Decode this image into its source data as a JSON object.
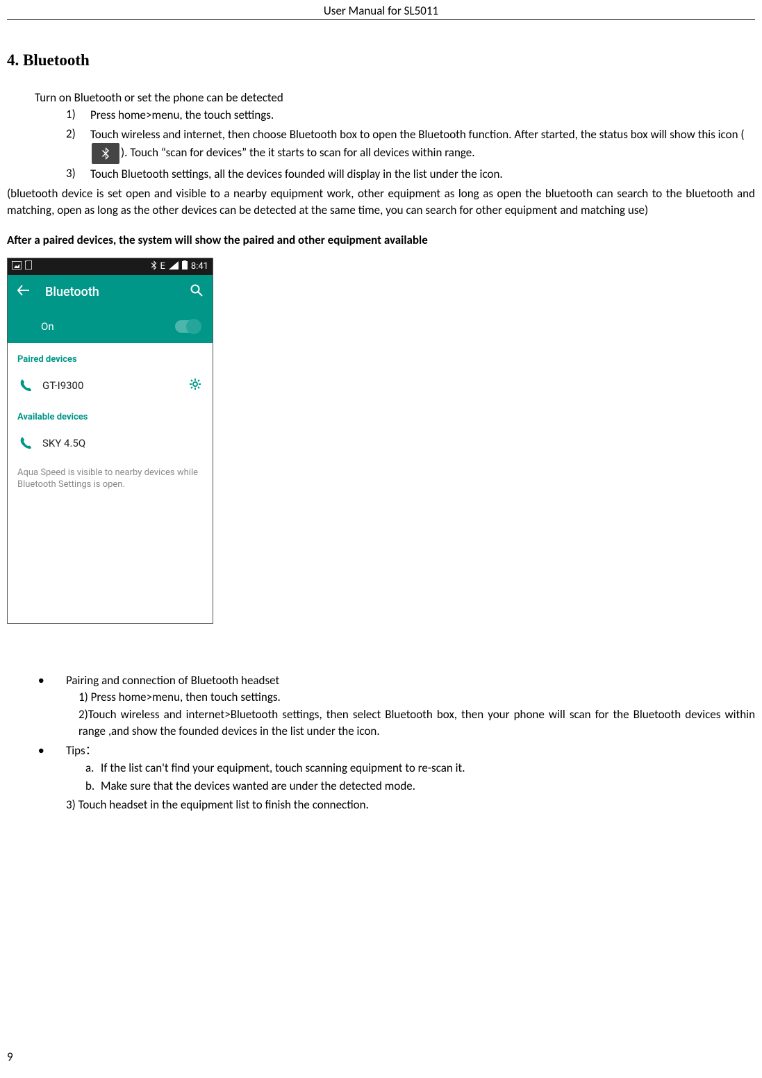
{
  "header": "User Manual for SL5011",
  "section_title": "4. Bluetooth",
  "intro": "Turn on Bluetooth or set the phone can be detected",
  "steps": {
    "n1": "1)",
    "t1": "Press home>menu, the touch settings.",
    "n2": "2)",
    "t2a": "Touch wireless and internet, then choose Bluetooth box to open the Bluetooth function. After started, the status box will show this icon (",
    "t2b": "). Touch  “scan for devices” the it starts to scan for all devices within range.",
    "n3": "3)",
    "t3": "Touch Bluetooth settings, all the devices founded will display in the list under the icon."
  },
  "note": "(bluetooth device is set open and visible to a nearby equipment work, other equipment as long as open the bluetooth can search to the bluetooth and matching, open as long as the other devices can be detected at the same time, you can search for other equipment and matching use)",
  "bold_line": "After a paired devices, the system will show the paired and other equipment available",
  "phone": {
    "status": {
      "signal_letter": "E",
      "time": "8:41"
    },
    "title": "Bluetooth",
    "on_label": "On",
    "paired_label": "Paired devices",
    "paired_device": "GT-I9300",
    "available_label": "Available devices",
    "available_device": "SKY 4.5Q",
    "visibility": "Aqua Speed is visible to nearby devices while Bluetooth Settings is open."
  },
  "pairing": {
    "heading": "Pairing and connection of Bluetooth headset",
    "l1": "1) Press home>menu, then touch settings.",
    "l2": "2)Touch wireless and internet>Bluetooth settings, then select Bluetooth box, then your phone will scan for the Bluetooth devices within range ,and show the founded devices in the list under the icon.",
    "tips_heading": "Tips：",
    "ta_m": "a.",
    "ta": "If the list can't find your equipment, touch scanning equipment to re-scan it.",
    "tb_m": "b.",
    "tb": "Make sure that the devices wanted are under the detected mode.",
    "l3": "3) Touch headset in the equipment list to finish the connection."
  },
  "page_number": "9"
}
